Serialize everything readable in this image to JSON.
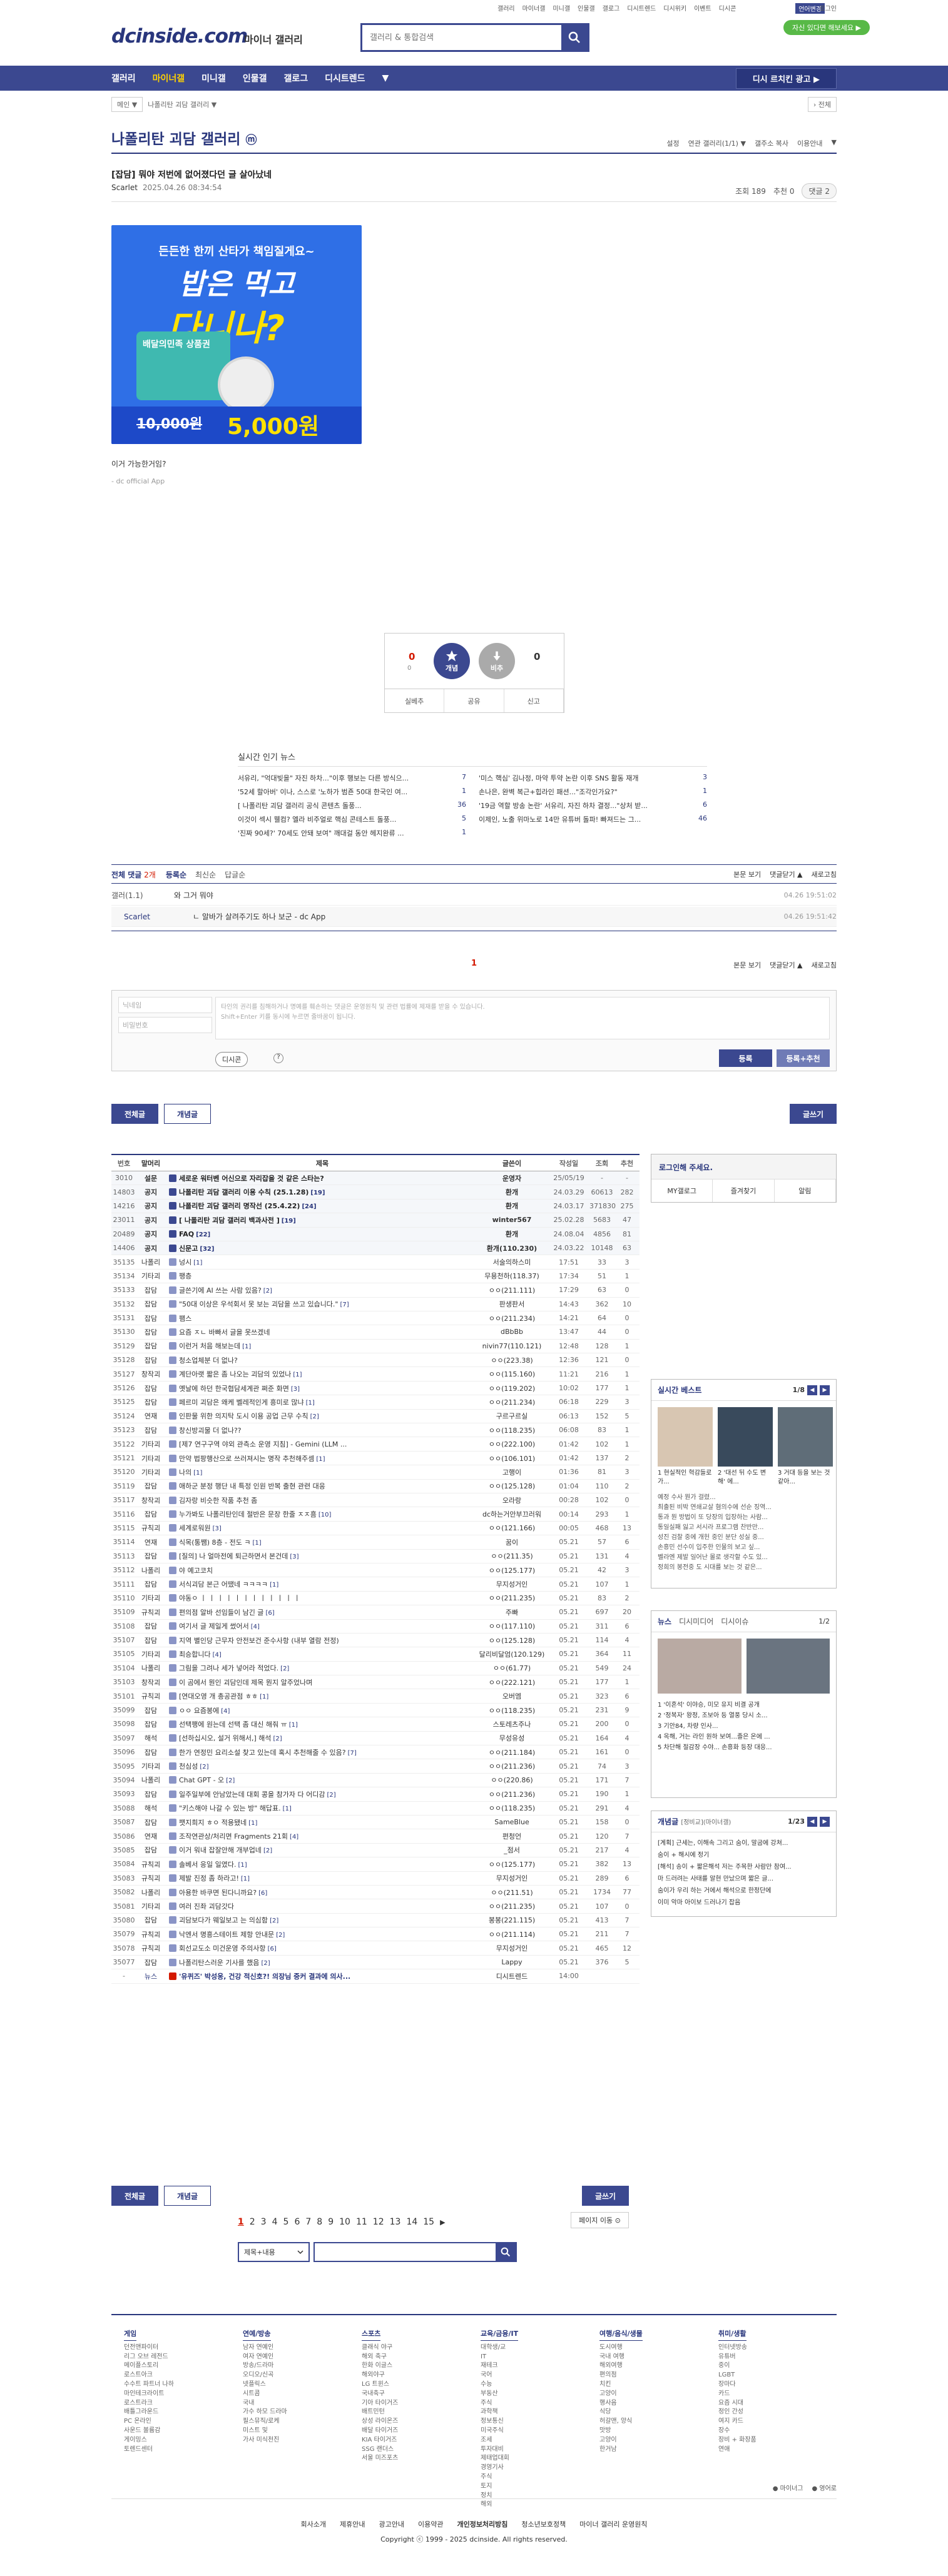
{
  "util": {
    "links": [
      "갤러리",
      "마이너갤",
      "미니갤",
      "인물갤",
      "갤로그",
      "디시트렌드",
      "디시위키",
      "이벤트",
      "디시콘"
    ],
    "lang": "언어변경",
    "login": "로그인"
  },
  "logo": {
    "brand": "dcinside.com",
    "section": "마이너 갤러리"
  },
  "search": {
    "placeholder": "갤러리 & 통합검색"
  },
  "badge": "자신 있다면 해보세요 ▶",
  "gnb": {
    "items": [
      "갤러리",
      "마이너갤",
      "미니갤",
      "인물갤",
      "갤로그",
      "디시트렌드"
    ],
    "more": "▼",
    "right_button": "디시 르치킨 광고 ▶"
  },
  "breadcrumb": {
    "home": "메인 ▼",
    "current": "나폴리탄 괴담 갤러리 ▼",
    "right": "› 전체"
  },
  "gallery": {
    "title": "나폴리탄 괴담 갤러리",
    "mark": "ⓜ",
    "options": [
      "설정",
      "연관 갤러리(1/1) ▼",
      "갤주소 복사",
      "이용안내",
      "▼"
    ]
  },
  "post": {
    "title": "[잡담] 뭐야 저번에 없어졌다던 글 살아났네",
    "writer": "Scarlet",
    "date": "2025.04.26 08:34:54",
    "views": "조회 189",
    "recommend": "추천 0",
    "comments": "댓글 2",
    "body": "이거 가능한거임?",
    "signature": "- dc official App"
  },
  "ad": {
    "line1": "든든한 한끼 산타가 책임질게요~",
    "line2": "밥은 먹고",
    "line3": "다니나?",
    "card": "배달의민족 상품권",
    "old_price": "10,000원",
    "new_price": "5,000원"
  },
  "vote": {
    "up_count": "0",
    "up_sub": "0",
    "up_label": "개념",
    "down_label": "비추",
    "down_count": "0",
    "actions": [
      "실베추",
      "공유",
      "신고"
    ]
  },
  "news": {
    "heading": "실시간 인기 뉴스",
    "left": [
      {
        "t": "서유리, \"억대빚을\" 자진 하차...\"이후 행보는 다른 방식으...",
        "c": "7"
      },
      {
        "t": "'52세 할아버' 이나, 스스로 '노하가 범죤 50대 한국인 여...",
        "c": "1"
      },
      {
        "t": "[ 나폴리탄 괴담 갤러리 공식 콘텐츠 돌풍...",
        "c": "36"
      },
      {
        "t": "이것이 섹시 웰컴? 엘라 비주얼로 핵심 콘테스트 돌풍...",
        "c": "5"
      },
      {
        "t": "'진짜 90세?' 70세도 안돼 보여\" 깨대걸 동안 헤지완류 ...",
        "c": "1"
      }
    ],
    "right": [
      {
        "t": "'미스 핵심' 김나정, 마약 투약 논란 이후 SNS 활동 재개",
        "c": "3"
      },
      {
        "t": "손나은, 완벽 복근+힙라인 패션...\"조각인가요?\"",
        "c": "1"
      },
      {
        "t": "'19금 역할 방송 논란' 서유리, 자진 하차 결정...\"상처 받...",
        "c": "6"
      },
      {
        "t": "이제인, 노출 위마노로 14만 유튜버 돌파! 빠져드는 그...",
        "c": "46"
      }
    ]
  },
  "comments": {
    "all": "전체 댓글",
    "count": "2개",
    "sorts": [
      "등록순",
      "최신순",
      "답글순"
    ],
    "right": [
      "본문 보기",
      "댓글닫기 ▲",
      "새로고침"
    ],
    "rows": [
      {
        "w": "갤러(1.1)",
        "txt": "와 그거 뭐야",
        "d": "04.26 19:51:02"
      },
      {
        "w": "Scarlet",
        "txt": "ㄴ 알바가 살려주기도 하나 보군 - dc App",
        "d": "04.26 19:51:42"
      }
    ],
    "page": "1",
    "nick_ph": "닉네임",
    "pw_ph": "비밀번호",
    "text_ph": "타인의 권리를 침해하거나 명예를 훼손하는 댓글은 운영원칙 및 관련 법률에 제재를 받을 수 있습니다.\nShift+Enter 키를 동시에 누르면 줄바꿈이 됩니다.",
    "dccon": "디시콘",
    "register": "등록",
    "register_rec": "등록+추천"
  },
  "tabs": {
    "all": "전체글",
    "concept": "개념글",
    "write": "글쓰기"
  },
  "list": {
    "headers": [
      "번호",
      "말머리",
      "제목",
      "글쓴이",
      "작성일",
      "조회",
      "추천"
    ],
    "rows": [
      {
        "no": "3010",
        "h": "설문",
        "t": "세로운 워터벤 어신으로 자리잡을 것 같은 스타는?",
        "w": "운영자",
        "d": "25/05/19",
        "v": "-",
        "r": "-",
        "n": true
      },
      {
        "no": "14803",
        "h": "공지",
        "t": "나폴리탄 괴담 갤러리 이용 수칙 (25.1.28)",
        "cm": "[19]",
        "w": "환개",
        "d": "24.03.29",
        "v": "60613",
        "r": "282",
        "n": true
      },
      {
        "no": "14216",
        "h": "공지",
        "t": "나폴리탄 괴담 갤러리 명작선 (25.4.22)",
        "cm": "[24]",
        "w": "환개",
        "d": "24.03.17",
        "v": "371830",
        "r": "275",
        "n": true
      },
      {
        "no": "23011",
        "h": "공지",
        "t": "[ 나폴리탄 괴담 갤러리 백과사전 ]",
        "cm": "[19]",
        "w": "winter567",
        "d": "25.02.28",
        "v": "5683",
        "r": "47",
        "n": true
      },
      {
        "no": "20489",
        "h": "공지",
        "t": "FAQ",
        "cm": "[22]",
        "w": "환개",
        "d": "24.08.04",
        "v": "4856",
        "r": "81",
        "n": true
      },
      {
        "no": "14406",
        "h": "공지",
        "t": "신문고",
        "cm": "[32]",
        "w": "환개(110.230)",
        "d": "24.03.22",
        "v": "10148",
        "r": "63",
        "n": true
      },
      {
        "no": "35135",
        "h": "나폴리",
        "t": "넝시",
        "cm": "[1]",
        "w": "서술의하스미",
        "d": "17:51",
        "v": "33",
        "r": "3"
      },
      {
        "no": "35134",
        "h": "기타괴",
        "t": "팽층",
        "w": "무용천하(118.37)",
        "d": "17:34",
        "v": "51",
        "r": "1"
      },
      {
        "no": "35133",
        "h": "잡담",
        "t": "글쓴기에 AI 쓰는 사람 있음?",
        "cm": "[2]",
        "w": "ㅇㅇ(211.111)",
        "d": "17:29",
        "v": "63",
        "r": "0"
      },
      {
        "no": "35132",
        "h": "잡담",
        "t": "\"50대 이상은 우석회서 못 보는 괴담을 쓰고 있습니다.\"",
        "cm": "[7]",
        "w": "판생판서",
        "d": "14:43",
        "v": "362",
        "r": "10"
      },
      {
        "no": "35131",
        "h": "잡담",
        "t": "팸스",
        "w": "ㅇㅇ(211.234)",
        "d": "14:21",
        "v": "64",
        "r": "0"
      },
      {
        "no": "35130",
        "h": "잡담",
        "t": "요즘 ㅈㄴ 바빠서 글을 못쓰겠네",
        "w": "dBbBb",
        "d": "13:47",
        "v": "44",
        "r": "0"
      },
      {
        "no": "35129",
        "h": "잡담",
        "t": "이런거 처음 해보는데",
        "cm": "[1]",
        "w": "nivin77(110.121)",
        "d": "12:48",
        "v": "128",
        "r": "1"
      },
      {
        "no": "35128",
        "h": "잡담",
        "t": "청소업체분 더 없나?",
        "w": "ㅇㅇ(223.38)",
        "d": "12:36",
        "v": "121",
        "r": "0"
      },
      {
        "no": "35127",
        "h": "창작괴",
        "t": "계단아랫 짧은 좀 나오는 괴담의 있었나",
        "cm": "[1]",
        "w": "ㅇㅇ(115.160)",
        "d": "11:21",
        "v": "216",
        "r": "1"
      },
      {
        "no": "35126",
        "h": "잡담",
        "t": "옛날에 하던 한국협담세계관 쩌준 화면",
        "cm": "[3]",
        "w": "ㅇㅇ(119.202)",
        "d": "10:02",
        "v": "177",
        "r": "1"
      },
      {
        "no": "35125",
        "h": "잡담",
        "t": "페르미 괴담은 왜케 벨레적인게 흥미로 많냐",
        "cm": "[1]",
        "w": "ㅇㅇ(211.234)",
        "d": "06:18",
        "v": "229",
        "r": "3"
      },
      {
        "no": "35124",
        "h": "연재",
        "t": "인판물 위한 의지탁 도시 이용 공업 근무 수칙",
        "cm": "[2]",
        "w": "구르구르실",
        "d": "06:13",
        "v": "152",
        "r": "5"
      },
      {
        "no": "35123",
        "h": "잡담",
        "t": "창신방괴물 더 없나??",
        "w": "ㅇㅇ(118.235)",
        "d": "06:08",
        "v": "83",
        "r": "1"
      },
      {
        "no": "35122",
        "h": "기타괴",
        "t": "[제7 연구구역 야외 관측소 운영 지침] - Gemini (LLM ...",
        "w": "ㅇㅇ(222.100)",
        "d": "01:42",
        "v": "102",
        "r": "1"
      },
      {
        "no": "35121",
        "h": "기타괴",
        "t": "만약 법팡행산으로 쓰러져시는 명작 추천해주셈",
        "cm": "[1]",
        "w": "ㅇㅇ(106.101)",
        "d": "01:42",
        "v": "137",
        "r": "2"
      },
      {
        "no": "35120",
        "h": "기타괴",
        "t": "나의",
        "cm": "[1]",
        "w": "고행이",
        "d": "01:36",
        "v": "81",
        "r": "3"
      },
      {
        "no": "35119",
        "h": "잡담",
        "t": "애하군 분정 행단 내 특정 인원 반복 출현 관련 대응",
        "w": "ㅇㅇ(125.128)",
        "d": "01:04",
        "v": "110",
        "r": "2"
      },
      {
        "no": "35117",
        "h": "창작괴",
        "t": "김자랑 비슷한 작품 추천 좀",
        "w": "오라랑",
        "d": "00:28",
        "v": "102",
        "r": "0"
      },
      {
        "no": "35116",
        "h": "잡담",
        "t": "누가봐도 나폴리탄인데 절반은 문장 한줄 ㅈㅈ흠",
        "cm": "[10]",
        "w": "dc하는거안부끄러워",
        "d": "00:14",
        "v": "293",
        "r": "1"
      },
      {
        "no": "35115",
        "h": "규칙괴",
        "t": "세계로워원",
        "cm": "[3]",
        "w": "ㅇㅇ(121.166)",
        "d": "00:05",
        "v": "468",
        "r": "13"
      },
      {
        "no": "35114",
        "h": "연재",
        "t": "식목(통쨈) 8층 - 전도 ㅋ",
        "cm": "[1]",
        "w": "꿈이",
        "d": "05.21",
        "v": "57",
        "r": "6"
      },
      {
        "no": "35113",
        "h": "잡담",
        "t": "[질의] 나 얼마전에 퇴근하면서 본건데",
        "cm": "[3]",
        "w": "ㅇㅇ(211.35)",
        "d": "05.21",
        "v": "131",
        "r": "4"
      },
      {
        "no": "35112",
        "h": "나폴리",
        "t": "야 예고코치",
        "w": "ㅇㅇ(125.177)",
        "d": "05.21",
        "v": "42",
        "r": "3"
      },
      {
        "no": "35111",
        "h": "잡담",
        "t": "서식괴담 본근 어땠네 ㅋㅋㅋㅋ",
        "cm": "[1]",
        "w": "무지성거인",
        "d": "05.21",
        "v": "107",
        "r": "1"
      },
      {
        "no": "35110",
        "h": "기타괴",
        "t": "야동ㅇ ㅣ ㅣ ㅣ ㅣ ㅣ ㅣ ㅣ ㅣ ㅣ ㅣ ㅣ ㅣ",
        "w": "ㅇㅇ(211.235)",
        "d": "05.21",
        "v": "83",
        "r": "2"
      },
      {
        "no": "35109",
        "h": "규칙괴",
        "t": "편의점 알바 선임들이 남긴 글",
        "cm": "[6]",
        "w": "주빠",
        "d": "05.21",
        "v": "697",
        "r": "20"
      },
      {
        "no": "35108",
        "h": "잡담",
        "t": "여기서 글 제일게 썼어서",
        "cm": "[4]",
        "w": "ㅇㅇ(117.110)",
        "d": "05.21",
        "v": "311",
        "r": "6"
      },
      {
        "no": "35107",
        "h": "잡담",
        "t": "지역 별인당 근무자 안전보건 준수사항 (내부 열람 전정)",
        "w": "ㅇㅇ(125.128)",
        "d": "05.21",
        "v": "114",
        "r": "4"
      },
      {
        "no": "35105",
        "h": "기타괴",
        "t": "최승합니다",
        "cm": "[4]",
        "w": "달리비달엄(120.129)",
        "d": "05.21",
        "v": "364",
        "r": "11"
      },
      {
        "no": "35104",
        "h": "나폴리",
        "t": "그림을 그려나 세가 넣어라 적었다.",
        "cm": "[2]",
        "w": "ㅇㅇ(61.77)",
        "d": "05.21",
        "v": "549",
        "r": "24"
      },
      {
        "no": "35103",
        "h": "창작괴",
        "t": "이 곰에서 뭔인 괴담인데 제목 뭔지 알주었나며",
        "w": "ㅇㅇ(222.121)",
        "d": "05.21",
        "v": "177",
        "r": "1"
      },
      {
        "no": "35101",
        "h": "규칙괴",
        "t": "[연대오영 개 총공관점 ㅎㅎ",
        "cm": "[1]",
        "w": "오버엠",
        "d": "05.21",
        "v": "323",
        "r": "6"
      },
      {
        "no": "35099",
        "h": "잡담",
        "t": "ㅇㅇ 요즘봉에",
        "cm": "[4]",
        "w": "ㅇㅇ(118.235)",
        "d": "05.21",
        "v": "231",
        "r": "9"
      },
      {
        "no": "35098",
        "h": "잡담",
        "t": "선택팽에 원는데 선택 좀 대신 해줘 ㅠ",
        "cm": "[1]",
        "w": "스토레츠주나",
        "d": "05.21",
        "v": "200",
        "r": "0"
      },
      {
        "no": "35097",
        "h": "해석",
        "t": "[선하십시오, 설거 위해서,] 해석",
        "cm": "[2]",
        "w": "무성유성",
        "d": "05.21",
        "v": "164",
        "r": "4"
      },
      {
        "no": "35096",
        "h": "잡담",
        "t": "한가 연정민 요리소설 찾고 있는데 혹시 추천해줄 수 있음?",
        "cm": "[7]",
        "w": "ㅇㅇ(211.184)",
        "d": "05.21",
        "v": "161",
        "r": "0"
      },
      {
        "no": "35095",
        "h": "기타괴",
        "t": "천심성",
        "cm": "[2]",
        "w": "ㅇㅇ(211.236)",
        "d": "05.21",
        "v": "74",
        "r": "3"
      },
      {
        "no": "35094",
        "h": "나폴리",
        "t": "Chat GPT - 오",
        "cm": "[2]",
        "w": "ㅇㅇ(220.86)",
        "d": "05.21",
        "v": "171",
        "r": "7"
      },
      {
        "no": "35093",
        "h": "잡담",
        "t": "일주일부에 안남았는데 대회 콩을 참가자 다 어디감",
        "cm": "[2]",
        "w": "ㅇㅇ(211.236)",
        "d": "05.21",
        "v": "190",
        "r": "1"
      },
      {
        "no": "35088",
        "h": "해석",
        "t": "\"키스해야 나갈 수 있는 방\" 해답표.",
        "cm": "[1]",
        "w": "ㅇㅇ(118.235)",
        "d": "05.21",
        "v": "291",
        "r": "4"
      },
      {
        "no": "35087",
        "h": "잡담",
        "t": "팻지희지 ㅎㅇ 적용됐네",
        "cm": "[1]",
        "w": "SameBlue",
        "d": "05.21",
        "v": "158",
        "r": "0"
      },
      {
        "no": "35086",
        "h": "연재",
        "t": "조작연관상/처리면 Fragments 21회",
        "cm": "[4]",
        "w": "편청언",
        "d": "05.21",
        "v": "120",
        "r": "7"
      },
      {
        "no": "35085",
        "h": "잡담",
        "t": "이거 워내 잡잘안해 개부업네",
        "cm": "[2]",
        "w": "_점서",
        "d": "05.21",
        "v": "217",
        "r": "4"
      },
      {
        "no": "35084",
        "h": "규칙괴",
        "t": "솔베서 응일 일였다.",
        "cm": "[1]",
        "w": "ㅇㅇ(125.177)",
        "d": "05.21",
        "v": "382",
        "r": "13"
      },
      {
        "no": "35083",
        "h": "규칙괴",
        "t": "제발 진정 좀 하라고!",
        "cm": "[1]",
        "w": "무지성거인",
        "d": "05.21",
        "v": "289",
        "r": "6"
      },
      {
        "no": "35082",
        "h": "나폴리",
        "t": "아용한 바쿠면 된다니까요?",
        "cm": "[6]",
        "w": "ㅇㅇ(211.51)",
        "d": "05.21",
        "v": "1734",
        "r": "77"
      },
      {
        "no": "35081",
        "h": "기타괴",
        "t": "여러 진좌 괴담갓다",
        "w": "ㅇㅇ(211.235)",
        "d": "05.21",
        "v": "107",
        "r": "0"
      },
      {
        "no": "35080",
        "h": "잡담",
        "t": "괴담보다가 웨일보고 는 의심함",
        "cm": "[2]",
        "w": "봉봉(221.115)",
        "d": "05.21",
        "v": "413",
        "r": "7"
      },
      {
        "no": "35079",
        "h": "규칙괴",
        "t": "낙엔서 명흥스테이트 제항 안내문",
        "cm": "[2]",
        "w": "ㅇㅇ(211.114)",
        "d": "05.21",
        "v": "211",
        "r": "7"
      },
      {
        "no": "35078",
        "h": "규칙괴",
        "t": "회선교도소 미건운영 주의사항",
        "cm": "[6]",
        "w": "무지성거인",
        "d": "05.21",
        "v": "465",
        "r": "12"
      },
      {
        "no": "35077",
        "h": "잡담",
        "t": "나폴리탄스러운 기사를 했음",
        "cm": "[2]",
        "w": "Lappy",
        "d": "05.21",
        "v": "376",
        "r": "5"
      },
      {
        "no": "-",
        "h": "뉴스",
        "t": "'유퀴즈' 박성웅, 건강 적신호?! 의장님 중커 결과에 의사...",
        "w": "디시트렌드",
        "d": "14:00",
        "v": "",
        "r": "",
        "news": true
      }
    ]
  },
  "side": {
    "login_msg": "로그인해 주세요.",
    "login_btns": [
      "MY갤로그",
      "즐겨찾기",
      "알림"
    ],
    "best_title": "실시간 베스트",
    "best_page": "1/8",
    "best_items": [
      "1 현실적인 혁감들로 가...",
      "2 '대선 뒤 수도 변해' 에...",
      "3 거대 등을 보는 것 같아..."
    ],
    "best_texts": [
      "예정 수사 뭔가 걸렸...",
      "최출된 비박 연쇄교살 혐의수에 선순 징역...",
      "통과 뭔 방법이 또 당장의 입장하는 사람...",
      "통일실패 잃고 서시라 프로그램 찬반만...",
      "성진 검찰 중에 개헌 중인 분단 성실 중...",
      "손흥민 선수이 입주한 인물의 보고 싶...",
      "벨라엔 제발 일어난 몰로 생각할 수도 있...",
      "정희의 봉전중 도 시대를 보는 것 같은..."
    ],
    "news_tabs": [
      "뉴스",
      "디시미디어",
      "디시이슈"
    ],
    "news_page": "1/2",
    "news_items": [
      "1 '이혼석' 이야승, 미모 유지 비결 공개",
      "2 '정복자' 왕정, 조보아 등 열풍 당시 소...",
      "3 기안84, 차량 인사...",
      "4 옥해, 거는 라인 원하 보여...졸은 온에 ...",
      "5 차단해 절감장 수야... 손흥화 등장 대응..."
    ],
    "game_title": "개념글",
    "game_sub": "[정비교](마이너갤)",
    "game_page": "1/23",
    "game_items": [
      "[계획] 근세는, 이해속 그리고 숨이, 말굽에 강쳐...",
      "숨이 + 해시에 정기",
      "[해석] 송이 + 짧은해석 저는 주목한 사람만 참여...",
      "마 드러려는 사태를 알현 만났으며 짧은 글...",
      "숨이가 우리 하는 거에서 해석으로 한정단에",
      "이미 악마 아이보 드러나기 잡음"
    ]
  },
  "pagination": {
    "pages": [
      "1",
      "2",
      "3",
      "4",
      "5",
      "6",
      "7",
      "8",
      "9",
      "10",
      "11",
      "12",
      "13",
      "14",
      "15"
    ],
    "next": "▶",
    "jump": "페이지 이동 ⊙"
  },
  "bsearch": {
    "select": "제목+내용"
  },
  "footer": {
    "cols": [
      {
        "h": "게임",
        "items": [
          "던전앤파이터",
          "리그 오브 레전드",
          "메이플스토리",
          "로스트아크",
          "수수트 파트너 나하",
          "마인테크라이트",
          "로스트라크",
          "배틀그라운드",
          "PC 온라인",
          "사운드 볼륨감",
          "게이밍스",
          "토렌드센터"
        ]
      },
      {
        "h": "연예/방송",
        "items": [
          "남자 연예인",
          "여자 연예인",
          "방송/드라마",
          "오디오/신곡",
          "넷플릭스",
          "시트콤",
          "국내",
          "가수 하모 드라마",
          "필스뮤직/로케",
          "미스트 및",
          "가사 미식천진"
        ]
      },
      {
        "h": "스포츠",
        "items": [
          "클래식 야구",
          "해외 축구",
          "한화 이글스",
          "해외야구",
          "LG 트윈스",
          "국내축구",
          "기아 타이거즈",
          "배트민턴",
          "상성 라이온즈",
          "배달 타이거즈",
          "KIA 타이거즈",
          "SSG 랜더스",
          "서울 미즈포츠"
        ]
      },
      {
        "h": "교육/금융/IT",
        "items": [
          "대학생/교",
          "IT",
          "재테크",
          "국어",
          "수능",
          "부동산",
          "주식",
          "과학책",
          "정보통신",
          "미국주식",
          "조세",
          "투자대비",
          "제태업대회",
          "경영기사",
          "주식",
          "토지",
          "정치",
          "해외"
        ]
      },
      {
        "h": "여행/음식/생물",
        "items": [
          "도시여행",
          "국내 여행",
          "해외여행",
          "편의점",
          "치킨",
          "고양이",
          "행사음",
          "식당",
          "허갈맨, 양식",
          "맛방",
          "고양이",
          "한거남"
        ]
      },
      {
        "h": "취미/생활",
        "items": [
          "인터넷방송",
          "유튜버",
          "중이",
          "LGBT",
          "장마다",
          "카드",
          "요즘 시대",
          "정인 간성",
          "여지 카드",
          "장수",
          "장비 + 화장품",
          "연애"
        ]
      }
    ],
    "lang_opts": [
      "● 마이너그",
      "● 영어로"
    ],
    "links": [
      "회사소개",
      "제휴안내",
      "광고안내",
      "이용약관",
      "개인정보처리방침",
      "청소년보호정책",
      "마이너 갤러리 운영원칙"
    ],
    "copyright": "Copyright ⓒ 1999 - 2025 dcinside. All rights reserved."
  }
}
